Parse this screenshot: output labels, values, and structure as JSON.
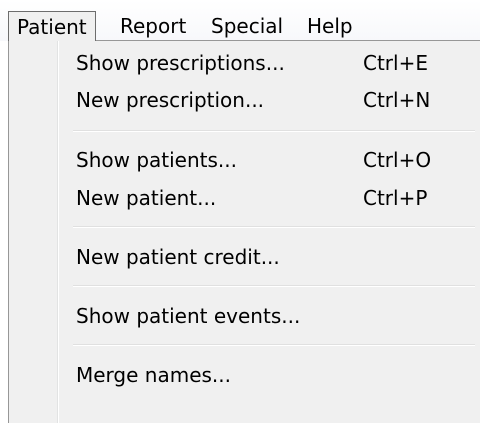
{
  "menubar": {
    "items": [
      {
        "label": "Patient"
      },
      {
        "label": "Report"
      },
      {
        "label": "Special"
      },
      {
        "label": "Help"
      }
    ]
  },
  "menu": {
    "items": [
      {
        "label": "Show prescriptions...",
        "shortcut": "Ctrl+E"
      },
      {
        "label": "New prescription...",
        "shortcut": "Ctrl+N"
      },
      {
        "label": "Show patients...",
        "shortcut": "Ctrl+O"
      },
      {
        "label": "New patient...",
        "shortcut": "Ctrl+P"
      },
      {
        "label": "New patient credit...",
        "shortcut": ""
      },
      {
        "label": "Show patient events...",
        "shortcut": ""
      },
      {
        "label": "Merge names...",
        "shortcut": ""
      }
    ]
  },
  "colors": {
    "menu_background": "#f0f0f0",
    "menubar_background": "#ffffff",
    "border": "#979797"
  }
}
